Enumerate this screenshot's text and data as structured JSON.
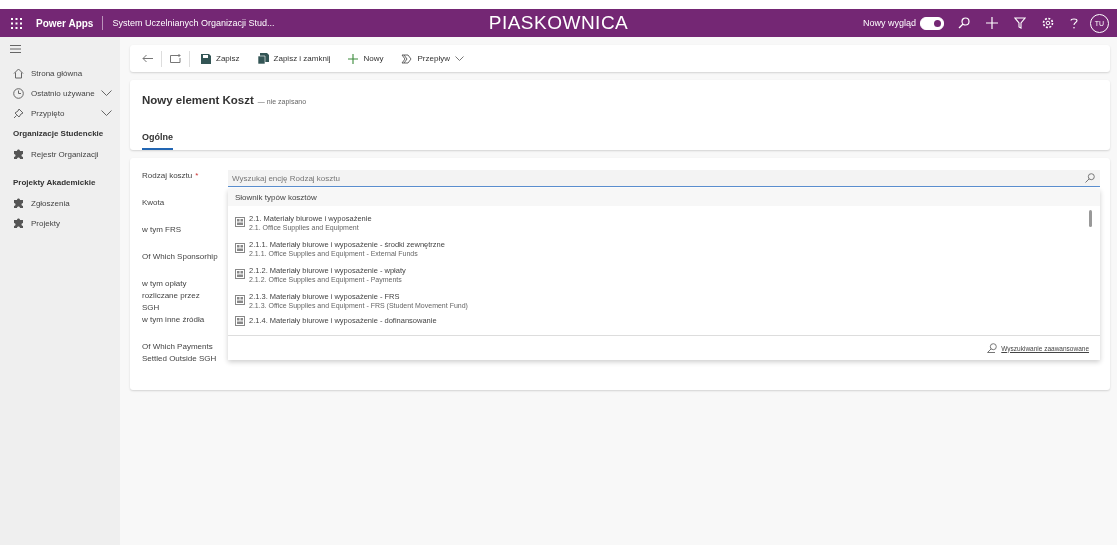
{
  "top_bar": {
    "app_name": "Power Apps",
    "app_title": "System Uczelnianych Organizacji Stud...",
    "environment": "PIASKOWNICA",
    "new_look": {
      "label": "Nowy wygląd",
      "on": true
    },
    "avatar": "TU"
  },
  "sidebar": {
    "items": [
      {
        "kind": "home",
        "label": "Strona główna",
        "expandable": false
      },
      {
        "kind": "recent",
        "label": "Ostatnio używane",
        "expandable": true
      },
      {
        "kind": "pinned",
        "label": "Przypięto",
        "expandable": true
      }
    ],
    "groups": [
      {
        "title": "Organizacje Studenckie",
        "items": [
          "Rejestr Organizacji"
        ]
      },
      {
        "title": "Projekty Akademickie",
        "items": [
          "Zgłoszenia",
          "Projekty"
        ]
      }
    ]
  },
  "toolbar": [
    {
      "kind": "save",
      "label": "Zapisz"
    },
    {
      "kind": "save_close",
      "label": "Zapisz i zamknij"
    },
    {
      "kind": "new",
      "label": "Nowy"
    },
    {
      "kind": "flow",
      "label": "Przepływ"
    }
  ],
  "header": {
    "title": "Nowy element Koszt",
    "status": "— nie zapisano"
  },
  "tabs": [
    {
      "label": "Ogólne",
      "selected": true
    }
  ],
  "form": {
    "fields": [
      {
        "label": "Rodzaj kosztu",
        "required_mark": "*"
      },
      {
        "label": "Kwota"
      },
      {
        "label": "w tym FRS"
      },
      {
        "label": "Of Which Sponsorhip"
      },
      {
        "label": "w tym opłaty rozliczane przez SGH"
      },
      {
        "label": "w tym inne źródła"
      },
      {
        "label": "Of Which Payments Settled Outside SGH"
      }
    ],
    "lookup": {
      "placeholder": "Wyszukaj encję Rodzaj kosztu",
      "dropdown": {
        "title": "Słownik typów kosztów",
        "items": [
          {
            "primary": "2.1. Materiały biurowe i wyposażenie",
            "secondary": "2.1. Office Supplies and Equipment"
          },
          {
            "primary": "2.1.1. Materiały biurowe i wyposażenie - środki zewnętrzne",
            "secondary": "2.1.1. Office Supplies and Equipment - External Funds"
          },
          {
            "primary": "2.1.2. Materiały biurowe i wyposażenie - wpłaty",
            "secondary": "2.1.2. Office Supplies and Equipment - Payments"
          },
          {
            "primary": "2.1.3. Materiały biurowe i wyposażenie - FRS",
            "secondary": "2.1.3. Office Supplies and Equipment - FRS (Student Movement Fund)"
          },
          {
            "primary": "2.1.4. Materiały biurowe i wyposażenie - dofinansowanie"
          }
        ],
        "advanced_search": "Wyszukiwanie zaawansowane"
      }
    }
  }
}
